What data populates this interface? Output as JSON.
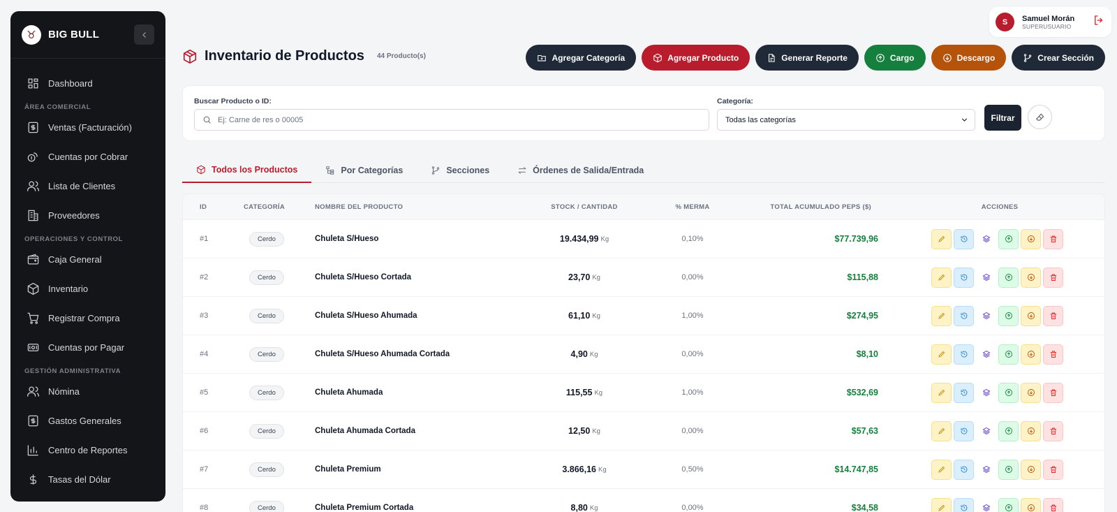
{
  "sidebar": {
    "brand": "BIG BULL",
    "sections": [
      {
        "title": "",
        "items": [
          {
            "label": "Dashboard",
            "icon": "dashboard-icon"
          }
        ]
      },
      {
        "title": "ÁREA COMERCIAL",
        "items": [
          {
            "label": "Ventas (Facturación)",
            "icon": "invoice-icon"
          },
          {
            "label": "Cuentas por Cobrar",
            "icon": "coins-icon"
          },
          {
            "label": "Lista de Clientes",
            "icon": "users-icon"
          },
          {
            "label": "Proveedores",
            "icon": "building-icon"
          }
        ]
      },
      {
        "title": "OPERACIONES Y CONTROL",
        "items": [
          {
            "label": "Caja General",
            "icon": "wallet-icon"
          },
          {
            "label": "Inventario",
            "icon": "box-icon"
          },
          {
            "label": "Registrar Compra",
            "icon": "cart-icon"
          },
          {
            "label": "Cuentas por Pagar",
            "icon": "money-icon"
          }
        ]
      },
      {
        "title": "GESTIÓN ADMINISTRATIVA",
        "items": [
          {
            "label": "Nómina",
            "icon": "users-icon"
          },
          {
            "label": "Gastos Generales",
            "icon": "invoice-icon"
          },
          {
            "label": "Centro de Reportes",
            "icon": "bar-chart-icon"
          },
          {
            "label": "Tasas del Dólar",
            "icon": "dollar-icon"
          }
        ]
      }
    ]
  },
  "user": {
    "initial": "S",
    "name": "Samuel Morán",
    "role": "SUPERUSUARIO"
  },
  "header": {
    "title": "Inventario de Productos",
    "count": "44 Producto(s)"
  },
  "actions": [
    {
      "label": "Agregar Categoría",
      "style": "dark",
      "icon": "folder-plus-icon"
    },
    {
      "label": "Agregar Producto",
      "style": "red",
      "icon": "box-icon"
    },
    {
      "label": "Generar Reporte",
      "style": "dark",
      "icon": "file-icon"
    },
    {
      "label": "Cargo",
      "style": "green",
      "icon": "arrow-up-circle-icon"
    },
    {
      "label": "Descargo",
      "style": "orange",
      "icon": "arrow-down-circle-icon"
    },
    {
      "label": "Crear Sección",
      "style": "dark",
      "icon": "branch-icon"
    }
  ],
  "filter": {
    "search_label": "Buscar Producto o ID:",
    "search_placeholder": "Ej: Carne de res o 00005",
    "category_label": "Categoría:",
    "category_value": "Todas las categorías",
    "filter_button": "Filtrar"
  },
  "tabs": [
    {
      "label": "Todos los Productos",
      "icon": "box-icon",
      "active": true
    },
    {
      "label": "Por Categorías",
      "icon": "tree-icon",
      "active": false
    },
    {
      "label": "Secciones",
      "icon": "branch-icon",
      "active": false
    },
    {
      "label": "Órdenes de Salida/Entrada",
      "icon": "swap-icon",
      "active": false
    }
  ],
  "table": {
    "columns": [
      "ID",
      "CATEGORÍA",
      "NOMBRE DEL PRODUCTO",
      "STOCK / CANTIDAD",
      "% MERMA",
      "TOTAL ACUMULADO PEPS ($)",
      "ACCIONES"
    ],
    "rows": [
      {
        "id": "#1",
        "category": "Cerdo",
        "name": "Chuleta S/Hueso",
        "stock": "19.434,99",
        "unit": "Kg",
        "merma": "0,10%",
        "total": "$77.739,96"
      },
      {
        "id": "#2",
        "category": "Cerdo",
        "name": "Chuleta S/Hueso Cortada",
        "stock": "23,70",
        "unit": "Kg",
        "merma": "0,00%",
        "total": "$115,88"
      },
      {
        "id": "#3",
        "category": "Cerdo",
        "name": "Chuleta S/Hueso Ahumada",
        "stock": "61,10",
        "unit": "Kg",
        "merma": "1,00%",
        "total": "$274,95"
      },
      {
        "id": "#4",
        "category": "Cerdo",
        "name": "Chuleta S/Hueso Ahumada Cortada",
        "stock": "4,90",
        "unit": "Kg",
        "merma": "0,00%",
        "total": "$8,10"
      },
      {
        "id": "#5",
        "category": "Cerdo",
        "name": "Chuleta Ahumada",
        "stock": "115,55",
        "unit": "Kg",
        "merma": "1,00%",
        "total": "$532,69"
      },
      {
        "id": "#6",
        "category": "Cerdo",
        "name": "Chuleta Ahumada Cortada",
        "stock": "12,50",
        "unit": "Kg",
        "merma": "0,00%",
        "total": "$57,63"
      },
      {
        "id": "#7",
        "category": "Cerdo",
        "name": "Chuleta Premium",
        "stock": "3.866,16",
        "unit": "Kg",
        "merma": "0,50%",
        "total": "$14.747,85"
      },
      {
        "id": "#8",
        "category": "Cerdo",
        "name": "Chuleta Premium Cortada",
        "stock": "8,80",
        "unit": "Kg",
        "merma": "0,00%",
        "total": "$34,58"
      }
    ]
  },
  "colors": {
    "accent": "#b91c2c",
    "dark": "#1f2937",
    "green": "#15803d",
    "orange": "#b45309",
    "sidebar": "#141518"
  }
}
